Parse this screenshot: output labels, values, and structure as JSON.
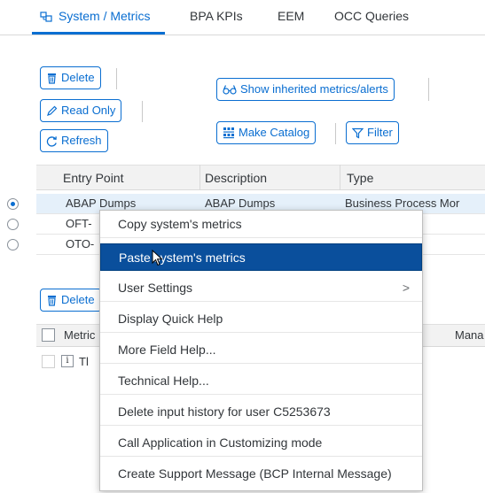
{
  "tabs": [
    {
      "label": "System / Metrics"
    },
    {
      "label": "BPA KPIs"
    },
    {
      "label": "EEM"
    },
    {
      "label": "OCC Queries"
    }
  ],
  "toolbar": {
    "delete_label": "Delete",
    "read_only_label": "Read Only",
    "refresh_label": "Refresh",
    "show_inherited_label": "Show inherited metrics/alerts",
    "make_catalog_label": "Make Catalog",
    "filter_label": "Filter"
  },
  "table": {
    "columns": [
      "Entry Point",
      "Description",
      "Type"
    ],
    "rows": [
      {
        "entry_point": "ABAP Dumps",
        "description": "ABAP Dumps",
        "type": "Business Process Mor",
        "selected": true
      },
      {
        "entry_point": "OFT-",
        "description": "",
        "type": "",
        "selected": false
      },
      {
        "entry_point": "OTO-",
        "description": "",
        "type": "",
        "selected": false
      }
    ]
  },
  "lower_table": {
    "delete_label": "Delete",
    "col_metric": "Metric",
    "col_mana": "Mana",
    "row_text": "Tl"
  },
  "context_menu": {
    "items": [
      {
        "label": "Copy system's metrics"
      },
      {
        "label": "Paste system's metrics",
        "highlighted": true
      },
      {
        "label": "User Settings",
        "submenu": ">"
      },
      {
        "label": "Display Quick Help"
      },
      {
        "label": "More Field Help..."
      },
      {
        "label": "Technical Help..."
      },
      {
        "label": "Delete input history for user C5253673"
      },
      {
        "label": "Call Application in Customizing mode"
      },
      {
        "label": "Create Support Message (BCP Internal Message)"
      }
    ]
  },
  "colors": {
    "accent": "#0a6ed1",
    "menu_highlight": "#0a4f9c",
    "selected_row": "#e5f0fa"
  },
  "icons": [
    "system-metrics-tab-icon",
    "trash-icon",
    "pencil-icon",
    "refresh-icon",
    "glasses-icon",
    "catalog-icon",
    "filter-icon",
    "info-icon",
    "chevron-right-icon",
    "mouse-cursor-icon"
  ]
}
